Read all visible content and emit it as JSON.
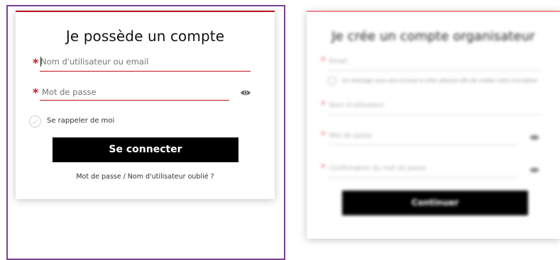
{
  "login": {
    "title": "Je possède un compte",
    "username_placeholder": "Nom d'utilisateur ou email",
    "password_placeholder": "Mot de passe",
    "remember_label": "Se rappeler de moi",
    "submit_label": "Se connecter",
    "forgot_link": "Mot de passe / Nom d'utilisateur oublié ?",
    "required_mark": "*"
  },
  "register": {
    "title": "Je crée un compte organisateur",
    "email_label": "Email",
    "email_info": "Un message vous sera envoyé à cette adresse afin de valider votre inscription",
    "username_label": "Nom d'utilisateur",
    "password_label": "Mot de passe",
    "confirm_label": "Confirmation du mot de passe",
    "submit_label": "Continuer",
    "required_mark": "*"
  },
  "colors": {
    "accent_red": "#c0121c",
    "frame_purple": "#7b3f92",
    "button_black": "#000000"
  }
}
